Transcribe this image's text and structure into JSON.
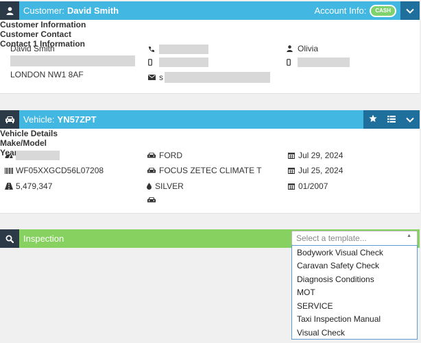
{
  "customer": {
    "label": "Customer:",
    "name": "David Smith",
    "account_info_label": "Account Info:",
    "account_badge": "CASH",
    "info": {
      "heading": "Customer Information",
      "name": "David Smith",
      "postcode": "LONDON NW1 8AF"
    },
    "contact": {
      "heading": "Customer Contact",
      "email_prefix": "s"
    },
    "contact1": {
      "heading": "Contact 1 Information",
      "name": "Olivia"
    }
  },
  "vehicle": {
    "label": "Vehicle:",
    "reg": "YN57ZPT",
    "details": {
      "heading": "Vehicle Details",
      "vin": "WF05XXGCD56L07208",
      "mileage": "5,479,347"
    },
    "make_model": {
      "heading": "Make/Model",
      "make": "FORD",
      "model": "FOCUS ZETEC CLIMATE T",
      "colour": "SILVER"
    },
    "year": {
      "heading": "Year",
      "date1": "Jul 29, 2024",
      "date2": "Jul 25, 2024",
      "year": "01/2007"
    }
  },
  "inspection": {
    "label": "Inspection",
    "select_placeholder": "Select a template...",
    "templates": [
      "Bodywork Visual Check",
      "Caravan Safety Check",
      "Diagnosis Conditions",
      "MOT",
      "SERVICE",
      "Taxi Inspection Manual",
      "Visual Check"
    ]
  },
  "colors": {
    "header_blue": "#41b7e2",
    "header_dark": "#2b3a46",
    "button_dark_blue": "#1f6f9c",
    "inspection_green": "#86d15f",
    "cash_badge": "#7fd26e"
  },
  "icons": {
    "customer": "user-icon",
    "vehicle": "car-icon",
    "inspection": "search-icon"
  }
}
